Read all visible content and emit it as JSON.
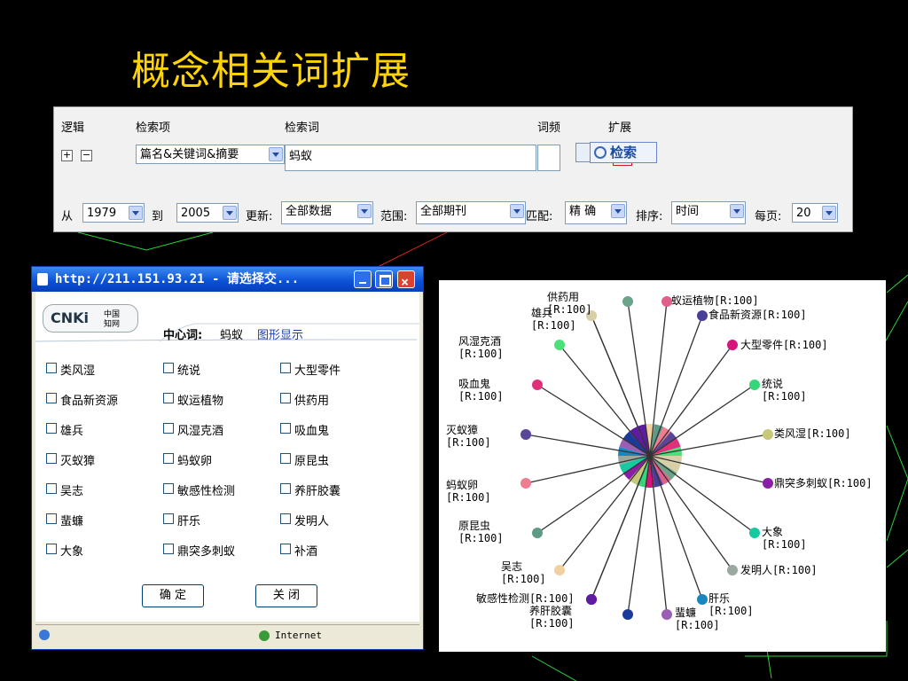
{
  "slide_title": "概念相关词扩展",
  "search": {
    "headers": {
      "logic": "逻辑",
      "field": "检索项",
      "term": "检索词",
      "freq": "词频",
      "expand": "扩展"
    },
    "field_value": "篇名&关键词&摘要",
    "term_value": "蚂蚁",
    "search_label": "检索",
    "from_label": "从",
    "from_value": "1979",
    "to_label": "到",
    "to_value": "2005",
    "update_label": "更新:",
    "update_value": "全部数据",
    "scope_label": "范围:",
    "scope_value": "全部期刊",
    "match_label": "匹配:",
    "match_value": "精 确",
    "sort_label": "排序:",
    "sort_value": "时间",
    "perpage_label": "每页:",
    "perpage_value": "20"
  },
  "popup": {
    "title": "http://211.151.93.21 - 请选择交...",
    "logo": "CNKi",
    "logo_sub1": "中国",
    "logo_sub2": "知网",
    "center_label": "中心词:",
    "center_word": "蚂蚁",
    "graph_link": "图形显示",
    "terms": [
      "类风湿",
      "统说",
      "大型零件",
      "食品新资源",
      "蚁运植物",
      "供药用",
      "雄兵",
      "风湿克酒",
      "吸血鬼",
      "灭蚁獐",
      "蚂蚁卵",
      "原昆虫",
      "吴志",
      "敏感性检测",
      "养肝胶囊",
      "蜚蠊",
      "肝乐",
      "发明人",
      "大象",
      "鼎突多刺蚁",
      "补酒"
    ],
    "ok_label": "确 定",
    "close_label": "关 闭",
    "status_zone": "Internet"
  },
  "graph": {
    "nodes": [
      {
        "label": "供药用",
        "r": "[R:100]",
        "color": "#d6cfa8"
      },
      {
        "label": "雄兵",
        "r": "[R:100]",
        "color": "#d6cfa8"
      },
      {
        "label": "",
        "r": "",
        "color": "#6aa58a"
      },
      {
        "label": "蚁运植物[R:100]",
        "r": "",
        "color": "#e0608a"
      },
      {
        "label": "食品新资源[R:100]",
        "r": "",
        "color": "#4a3f96"
      },
      {
        "label": "大型零件[R:100]",
        "r": "",
        "color": "#d4157a"
      },
      {
        "label": "统说",
        "r": "[R:100]",
        "color": "#37d67a"
      },
      {
        "label": "类风湿[R:100]",
        "r": "",
        "color": "#c8c77a"
      },
      {
        "label": "鼎突多刺蚁[R:100]",
        "r": "",
        "color": "#8b1ea6"
      },
      {
        "label": "大象",
        "r": "[R:100]",
        "color": "#16c9a0"
      },
      {
        "label": "发明人[R:100]",
        "r": "",
        "color": "#9aa8a0"
      },
      {
        "label": "肝乐",
        "r": "[R:100]",
        "color": "#1a86c0"
      },
      {
        "label": "蜚蠊",
        "r": "[R:100]",
        "color": "#9a5fb5"
      },
      {
        "label": "",
        "r": "",
        "color": "#1c3a9a"
      },
      {
        "label": "养肝胶囊",
        "r": "[R:100]",
        "color": "#5e1aa0"
      },
      {
        "label": "敏感性检测[R:100]",
        "r": "",
        "color": "#5e1aa0"
      },
      {
        "label": "吴志",
        "r": "[R:100]",
        "color": "#f2d1a0"
      },
      {
        "label": "原昆虫",
        "r": "[R:100]",
        "color": "#5e9a88"
      },
      {
        "label": "蚂蚁卵",
        "r": "[R:100]",
        "color": "#f07c90"
      },
      {
        "label": "灭蚁獐",
        "r": "[R:100]",
        "color": "#5a4696"
      },
      {
        "label": "吸血鬼",
        "r": "[R:100]",
        "color": "#e0307a"
      },
      {
        "label": "风湿克酒",
        "r": "[R:100]",
        "color": "#4ae07a"
      }
    ]
  }
}
